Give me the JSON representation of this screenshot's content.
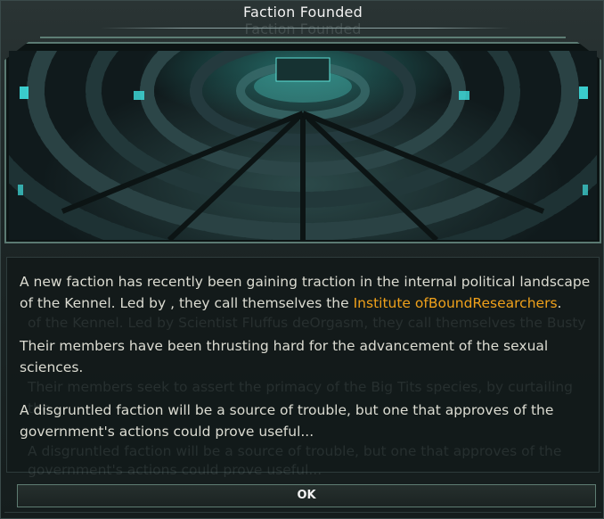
{
  "dialog": {
    "title": "Faction Founded",
    "title_ghost": "Faction Founded",
    "paragraph1": {
      "before": "A new faction has recently been gaining traction in the internal political landscape of the Kennel. Led by  , they call themselves the ",
      "faction_name": "Institute ofBoundResearchers",
      "after": "."
    },
    "paragraph2": "Their members have been thrusting hard for the advancement of the sexual sciences.",
    "paragraph3": "A disgruntled faction will be a source of trouble, but one that approves of the government's actions could prove useful...",
    "ghost_lines": [
      "of the Kennel. Led by Scientist Fluffus deOrgasm, they call themselves the Busty",
      "Their members seek to assert the primacy of the Big Tits species, by curtailing the",
      "A disgruntled faction will be a source of trouble, but one that approves of the",
      "government's actions could prove useful..."
    ],
    "ok_label": "OK"
  },
  "colors": {
    "accent_highlight": "#f0a11a",
    "frame": "#5b7a72",
    "text": "#dcdcd2"
  }
}
